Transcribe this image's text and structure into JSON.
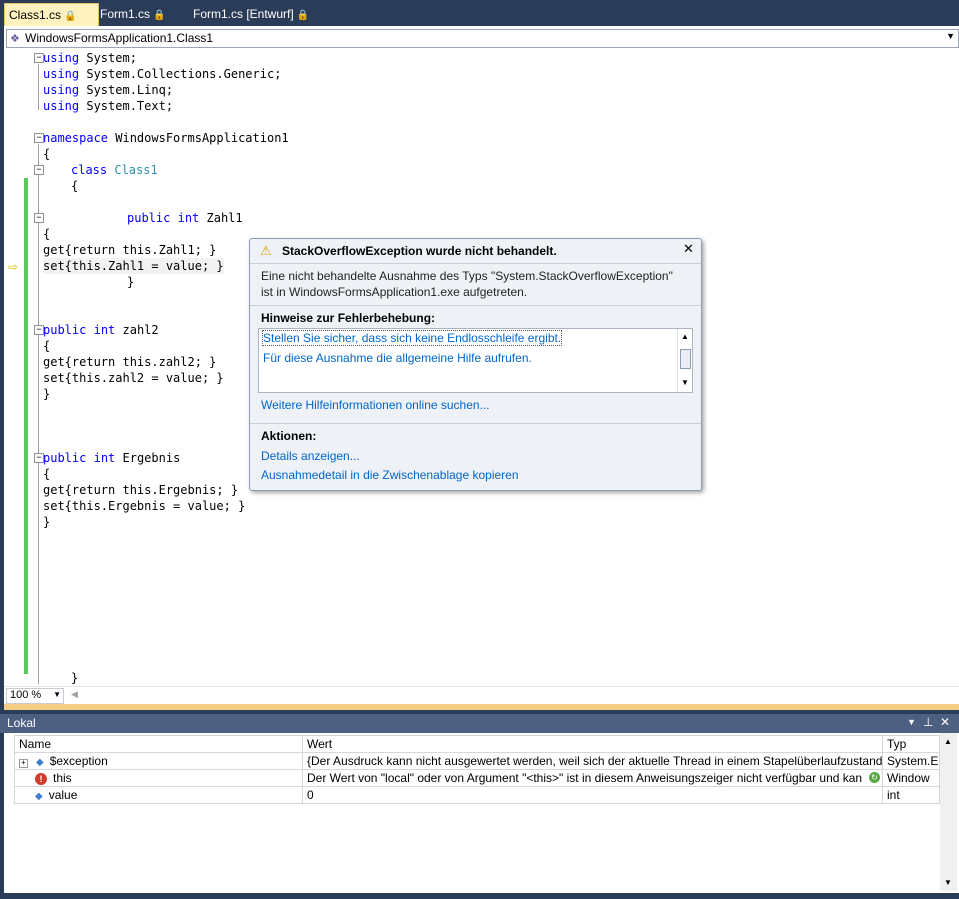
{
  "tabs": [
    {
      "label": "Class1.cs",
      "locked": true,
      "active": true
    },
    {
      "label": "Form1.cs",
      "locked": true,
      "active": false
    },
    {
      "label": "Form1.cs [Entwurf]",
      "locked": true,
      "active": false
    }
  ],
  "nav": {
    "class_selector": "WindowsFormsApplication1.Class1"
  },
  "code": {
    "lines": [
      {
        "keyword": "using",
        "text": " System;"
      },
      {
        "keyword": "using",
        "text": " System.Collections.Generic;"
      },
      {
        "keyword": "using",
        "text": " System.Linq;"
      },
      {
        "keyword": "using",
        "text": " System.Text;"
      },
      {
        "keyword": "namespace",
        "text": " WindowsFormsApplication1"
      },
      {
        "text": "{"
      },
      {
        "keyword": "class",
        "type": "Class1"
      },
      {
        "text": "{"
      },
      {
        "keyword": "public",
        "keyword2": "int",
        "text": " Zahl1"
      },
      {
        "text": "{"
      },
      {
        "text": "get{return this.Zahl1; }"
      },
      {
        "text": "set{this.Zahl1 = value; }"
      },
      {
        "text": "}"
      },
      {
        "keyword": "public",
        "keyword2": "int",
        "text": " zahl2"
      },
      {
        "text": "{"
      },
      {
        "text": "get{return this.zahl2; }"
      },
      {
        "text": "set{this.zahl2 = value; }"
      },
      {
        "text": "}"
      },
      {
        "keyword": "public",
        "keyword2": "int",
        "text": " Ergebnis"
      },
      {
        "text": "{"
      },
      {
        "text": "get{return this.Ergebnis; }"
      },
      {
        "text": "set{this.Ergebnis = value; }"
      },
      {
        "text": "}"
      },
      {
        "text": "}"
      }
    ]
  },
  "exception": {
    "title": "StackOverflowException wurde nicht behandelt.",
    "message": "Eine nicht behandelte Ausnahme des Typs \"System.StackOverflowException\" ist in WindowsFormsApplication1.exe aufgetreten.",
    "tips_header": "Hinweise zur Fehlerbehebung:",
    "tips": [
      "Stellen Sie sicher, dass sich keine Endlosschleife ergibt.",
      "Für diese Ausnahme die allgemeine Hilfe aufrufen."
    ],
    "online_help": "Weitere Hilfeinformationen online suchen...",
    "actions_header": "Aktionen:",
    "actions": [
      "Details anzeigen...",
      "Ausnahmedetail in die Zwischenablage kopieren"
    ]
  },
  "zoom": "100 %",
  "locals": {
    "title": "Lokal",
    "columns": [
      "Name",
      "Wert",
      "Typ"
    ],
    "rows": [
      {
        "name": "$exception",
        "value": "{Der Ausdruck kann nicht ausgewertet werden, weil sich der aktuelle Thread in einem Stapelüberlaufzustand b",
        "type": "System.E"
      },
      {
        "name": "this",
        "value": "Der Wert von \"local\" oder von Argument \"<this>\" ist in diesem Anweisungszeiger nicht verfügbar und kan",
        "type": "Window"
      },
      {
        "name": "value",
        "value": "0",
        "type": "int"
      }
    ]
  }
}
